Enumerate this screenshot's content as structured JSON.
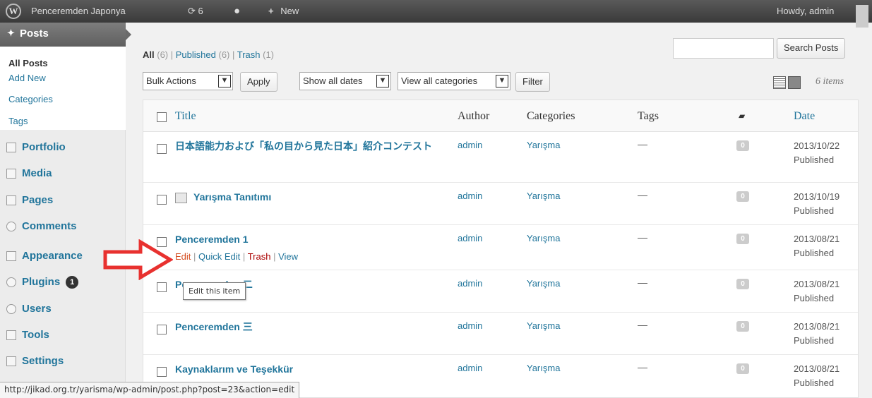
{
  "admin_bar": {
    "site_name": "Penceremden Japonya",
    "updates_count": "6",
    "new_label": "New",
    "howdy": "Howdy, admin"
  },
  "sidebar": {
    "posts_label": "Posts",
    "submenu": [
      "All Posts",
      "Add New",
      "Categories",
      "Tags"
    ],
    "menu": [
      {
        "label": "Portfolio",
        "icon": "portfolio-icon"
      },
      {
        "label": "Media",
        "icon": "media-icon"
      },
      {
        "label": "Pages",
        "icon": "pages-icon"
      },
      {
        "label": "Comments",
        "icon": "comments-icon"
      },
      {
        "label": "Appearance",
        "icon": "appearance-icon"
      },
      {
        "label": "Plugins",
        "icon": "plugins-icon",
        "badge": "1"
      },
      {
        "label": "Users",
        "icon": "users-icon"
      },
      {
        "label": "Tools",
        "icon": "tools-icon"
      },
      {
        "label": "Settings",
        "icon": "settings-icon"
      }
    ]
  },
  "views": {
    "all": "All",
    "all_count": "(6)",
    "published": "Published",
    "published_count": "(6)",
    "trash": "Trash",
    "trash_count": "(1)"
  },
  "search": {
    "placeholder": "",
    "button": "Search Posts"
  },
  "filters": {
    "bulk_actions": "Bulk Actions",
    "apply": "Apply",
    "dates": "Show all dates",
    "categories": "View all categories",
    "filter": "Filter"
  },
  "items_count": "6 items",
  "columns": {
    "title": "Title",
    "author": "Author",
    "categories": "Categories",
    "tags": "Tags",
    "date": "Date"
  },
  "rows": [
    {
      "title": "日本語能力および「私の目から見た日本」紹介コンテスト",
      "author": "admin",
      "category": "Yarışma",
      "tags": "—",
      "comments": "0",
      "date": "2013/10/22",
      "status": "Published"
    },
    {
      "title": "Yarışma Tanıtımı",
      "author": "admin",
      "category": "Yarışma",
      "tags": "—",
      "comments": "0",
      "date": "2013/10/19",
      "status": "Published"
    },
    {
      "title": "Penceremden 1",
      "author": "admin",
      "category": "Yarışma",
      "tags": "—",
      "comments": "0",
      "date": "2013/08/21",
      "status": "Published"
    },
    {
      "title": "Penceremden 二",
      "author": "admin",
      "category": "Yarışma",
      "tags": "—",
      "comments": "0",
      "date": "2013/08/21",
      "status": "Published"
    },
    {
      "title": "Penceremden 三",
      "author": "admin",
      "category": "Yarışma",
      "tags": "—",
      "comments": "0",
      "date": "2013/08/21",
      "status": "Published"
    },
    {
      "title": "Kaynaklarım ve Teşekkür",
      "author": "admin",
      "category": "Yarışma",
      "tags": "—",
      "comments": "0",
      "date": "2013/08/21",
      "status": "Published"
    }
  ],
  "row_actions": {
    "edit": "Edit",
    "quick_edit": "Quick Edit",
    "trash": "Trash",
    "view": "View",
    "sep": "|"
  },
  "tooltip": "Edit this item",
  "status_url": "http://jikad.org.tr/yarisma/wp-admin/post.php?post=23&action=edit",
  "colors": {
    "link": "#21759b",
    "edit": "#d54e21",
    "trash": "#aa0000",
    "arrow": "#e8312f"
  }
}
